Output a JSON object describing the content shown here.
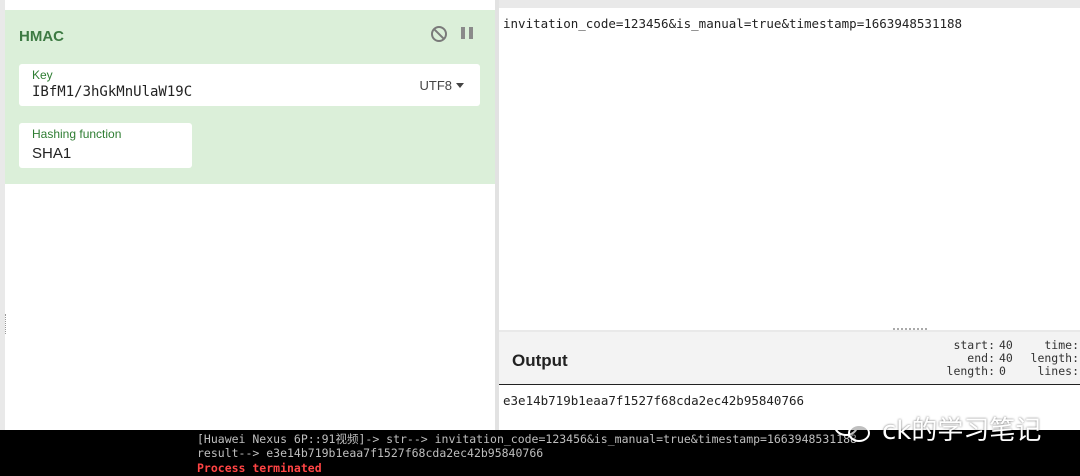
{
  "recipe": {
    "operation_title": "HMAC",
    "key_label": "Key",
    "key_value": "IBfM1/3hGkMnUlaW19C",
    "key_encoding": "UTF8",
    "hash_label": "Hashing function",
    "hash_value": "SHA1"
  },
  "input": {
    "text": "invitation_code=123456&is_manual=true&timestamp=1663948531188"
  },
  "output": {
    "title": "Output",
    "stats_a": [
      {
        "label": "start:",
        "value": "40"
      },
      {
        "label": "end:",
        "value": "40"
      },
      {
        "label": "length:",
        "value": "0"
      }
    ],
    "stats_b": [
      {
        "label": "time:"
      },
      {
        "label": "length:"
      },
      {
        "label": "lines:"
      }
    ],
    "text": "e3e14b719b1eaa7f1527f68cda2ec42b95840766"
  },
  "terminal": {
    "line1": "[Huawei Nexus 6P::91视频]-> str--> invitation_code=123456&is_manual=true&timestamp=1663948531188",
    "line2": "result--> e3e14b719b1eaa7f1527f68cda2ec42b95840766",
    "line3": "Process terminated"
  },
  "watermark": {
    "text": "ck的学习笔记",
    "icon": "wechat-icon"
  }
}
